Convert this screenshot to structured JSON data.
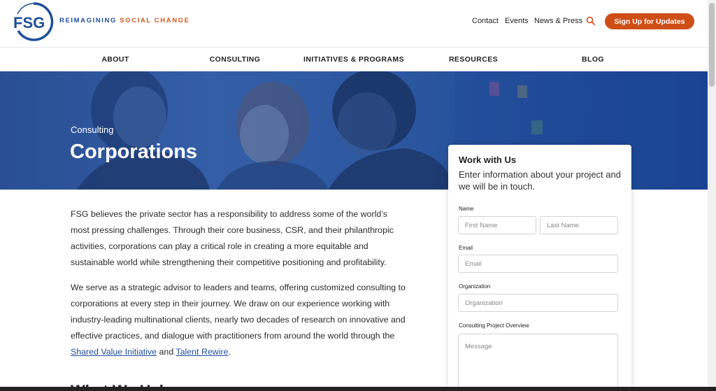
{
  "header": {
    "logo_text": "FSG",
    "tagline_part1": "REIMAGINING",
    "tagline_part2": "SOCIAL CHANGE",
    "links": [
      "Contact",
      "Events",
      "News & Press"
    ],
    "signup_label": "Sign Up for Updates"
  },
  "nav": [
    "ABOUT",
    "CONSULTING",
    "INITIATIVES & PROGRAMS",
    "RESOURCES",
    "BLOG"
  ],
  "hero": {
    "eyebrow": "Consulting",
    "title": "Corporations"
  },
  "content": {
    "p1": "FSG believes the private sector has a responsibility to address some of the world’s most pressing challenges. Through their core business, CSR, and their philanthropic activities, corporations can play a critical role in creating a more equitable and sustainable world while strengthening their competitive positioning and profitability.",
    "p2_text": "We serve as a strategic advisor to leaders and teams, offering customized consulting to corporations at every step in their journey. We draw on our experience working with industry-leading multinational clients, nearly two decades of research on innovative and effective practices, and dialogue with practitioners from around the world through the",
    "p2_link1": "Shared Value Initiative",
    "p2_and": "and",
    "p2_link2": "Talent Rewire",
    "p2_end": ".",
    "next_heading": "What We Help"
  },
  "form": {
    "title": "Work with Us",
    "subtitle": "Enter information about your project and we will be in touch.",
    "name_label": "Name",
    "first_placeholder": "First Name",
    "last_placeholder": "Last Name",
    "email_label": "Email",
    "email_placeholder": "Email",
    "org_label": "Organization",
    "org_placeholder": "Organization",
    "overview_label": "Consulting Project Overview",
    "message_placeholder": "Message"
  },
  "colors": {
    "brand_blue": "#1f4e99",
    "brand_orange": "#cf4e17",
    "hero_blue": "#2f5aa0"
  },
  "icons": [
    "fsg-logo",
    "search-icon"
  ]
}
